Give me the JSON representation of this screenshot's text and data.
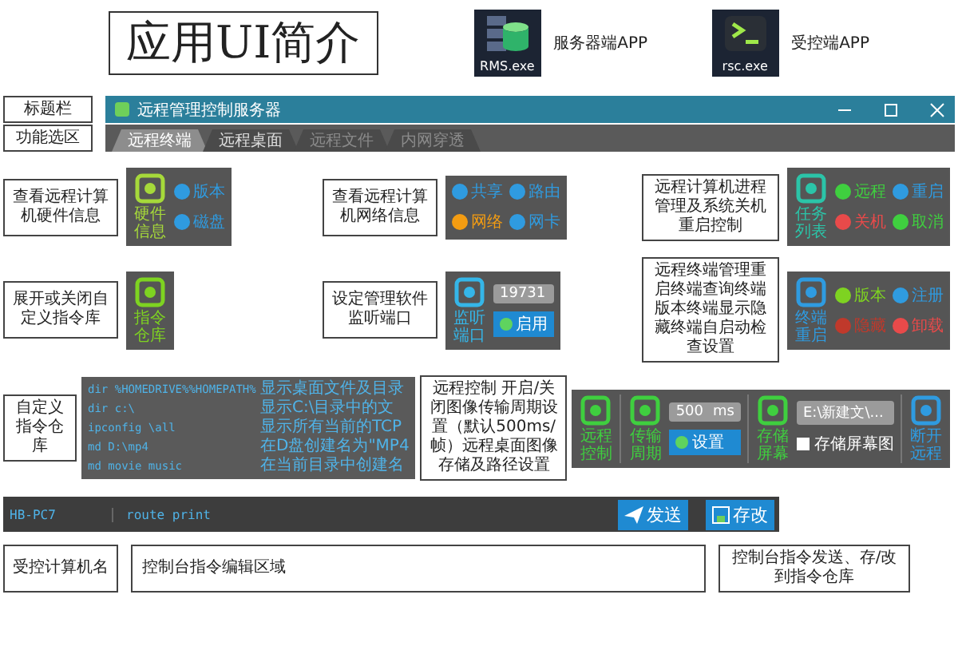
{
  "header": {
    "title": "应用UI简介",
    "apps": [
      {
        "kind": "database",
        "file": "RMS.exe",
        "label": "服务器端APP"
      },
      {
        "kind": "prompt",
        "file": "rsc.exe",
        "label": "受控端APP"
      }
    ]
  },
  "window": {
    "titlebar_note": "标题栏",
    "tabs_note": "功能选区",
    "title": "远程管理控制服务器",
    "tabs": [
      {
        "label": "远程终端",
        "selected": true,
        "disabled": false
      },
      {
        "label": "远程桌面",
        "selected": false,
        "disabled": false
      },
      {
        "label": "远程文件",
        "selected": false,
        "disabled": true
      },
      {
        "label": "内网穿透",
        "selected": false,
        "disabled": true
      }
    ]
  },
  "feature_rows": [
    [
      {
        "note": "查看远程计算机硬件信息",
        "columns": [
          [
            {
              "kind": "big",
              "label": "硬件信息",
              "color": "#a6d93a"
            }
          ],
          [
            {
              "kind": "small",
              "label": "版本",
              "color": "#2f9be0"
            },
            {
              "kind": "small",
              "label": "磁盘",
              "color": "#2f9be0"
            }
          ]
        ]
      },
      {
        "note": "查看远程计算机网络信息",
        "columns": [
          [
            {
              "kind": "small",
              "label": "共享",
              "color": "#2f9be0"
            },
            {
              "kind": "small",
              "label": "网络",
              "color": "#f39c12"
            }
          ],
          [
            {
              "kind": "small",
              "label": "路由",
              "color": "#2f9be0"
            },
            {
              "kind": "small",
              "label": "网卡",
              "color": "#2f9be0"
            }
          ]
        ]
      },
      {
        "note": "远程计算机进程管理及系统关机重启控制",
        "columns": [
          [
            {
              "kind": "big",
              "label": "任务列表",
              "color": "#2bc4a8"
            }
          ],
          [
            {
              "kind": "small",
              "label": "远程",
              "color": "#3fcf3f"
            },
            {
              "kind": "small",
              "label": "关机",
              "color": "#e84a4a"
            }
          ],
          [
            {
              "kind": "small",
              "label": "重启",
              "color": "#2f9be0"
            },
            {
              "kind": "small",
              "label": "取消",
              "color": "#3fcf3f"
            }
          ]
        ]
      }
    ],
    [
      {
        "note": "展开或关闭自定义指令库",
        "columns": [
          [
            {
              "kind": "big",
              "label": "指令仓库",
              "color": "#7ed321"
            }
          ]
        ]
      },
      {
        "note": "设定管理软件监听端口",
        "columns": [
          [
            {
              "kind": "big",
              "label": "监听端口",
              "color": "#35b6e8"
            }
          ],
          [
            {
              "kind": "field",
              "value": "19731"
            },
            {
              "kind": "button",
              "label": "启用"
            }
          ]
        ]
      },
      {
        "note": "远程终端管理重启终端查询终端版本终端显示隐藏终端自启动检查设置",
        "columns": [
          [
            {
              "kind": "big",
              "label": "终端重启",
              "color": "#2f9be0"
            }
          ],
          [
            {
              "kind": "small",
              "label": "版本",
              "color": "#7ed321"
            },
            {
              "kind": "small",
              "label": "隐藏",
              "color": "#c0392b"
            }
          ],
          [
            {
              "kind": "small",
              "label": "注册",
              "color": "#2f9be0"
            },
            {
              "kind": "small",
              "label": "卸载",
              "color": "#e84a4a"
            }
          ]
        ]
      }
    ]
  ],
  "command_library": {
    "note": "自定义指令仓库",
    "rows": [
      {
        "command": "dir %HOMEDRIVE%%HOMEPATH%",
        "description": "显示桌面文件及目录"
      },
      {
        "command": "dir c:\\",
        "description": "显示C:\\目录中的文"
      },
      {
        "command": "ipconfig \\all",
        "description": "显示所有当前的TCP"
      },
      {
        "command": "md D:\\mp4",
        "description": "在D盘创建名为\"MP4"
      },
      {
        "command": "md movie music",
        "description": "在当前目录中创建名"
      }
    ]
  },
  "remote_desktop": {
    "note": "远程控制 开启/关闭图像传输周期设置（默认500ms/帧）远程桌面图像存储及路径设置",
    "sections": [
      [
        [
          {
            "kind": "big",
            "label": "远程控制",
            "color": "#3fcf3f"
          }
        ]
      ],
      [
        [
          {
            "kind": "big",
            "label": "传输周期",
            "color": "#3fcf3f"
          }
        ],
        [
          {
            "kind": "field",
            "value": "500",
            "unit": "ms"
          },
          {
            "kind": "button",
            "label": "设置"
          }
        ]
      ],
      [
        [
          {
            "kind": "big",
            "label": "存储屏幕",
            "color": "#3fcf3f"
          }
        ],
        [
          {
            "kind": "field",
            "value": "E:\\新建文\\..."
          },
          {
            "kind": "check",
            "label": "存储屏幕图",
            "checked": false
          }
        ]
      ],
      [
        [
          {
            "kind": "big",
            "label": "断开远程",
            "color": "#2f9be0"
          }
        ]
      ]
    ]
  },
  "console": {
    "host": "HB-PC7",
    "command": "route print",
    "buttons": [
      {
        "kind": "send",
        "label": "发送"
      },
      {
        "kind": "save",
        "label": "存改"
      }
    ]
  },
  "bottom_notes": [
    "受控计算机名",
    "控制台指令编辑区域",
    "控制台指令发送、存/改到指令仓库"
  ]
}
